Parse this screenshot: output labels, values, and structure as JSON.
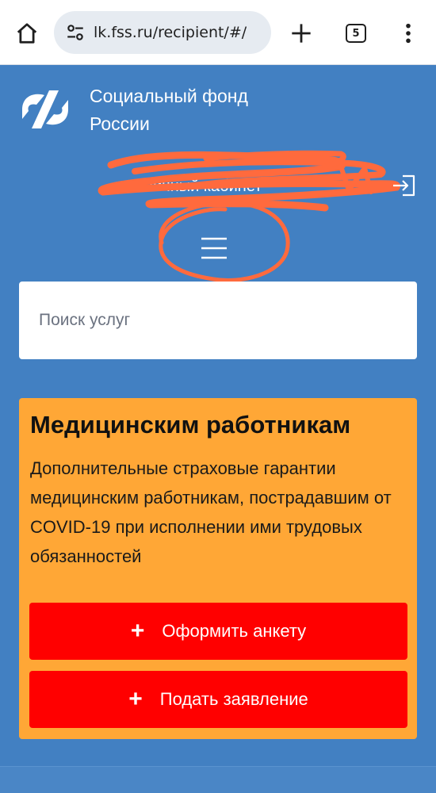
{
  "browser": {
    "url": "lk.fss.ru/recipient/#/",
    "tab_count": "5"
  },
  "header": {
    "org_name": "Социальный фонд России",
    "account_text": "Личный кабинет"
  },
  "search": {
    "placeholder": "Поиск услуг"
  },
  "card": {
    "title": "Медицинским работникам",
    "description": "Дополнительные страховые гарантии медицинским работникам, пострадавшим от COVID-19 при исполнении ими трудовых обязанностей",
    "button_primary": "Оформить анкету",
    "button_secondary": "Подать заявление",
    "plus_symbol": "+"
  },
  "colors": {
    "page_bg": "#4280c2",
    "card_bg": "#ffa736",
    "button_bg": "#ff0000",
    "scribble": "#ff6a3d"
  }
}
